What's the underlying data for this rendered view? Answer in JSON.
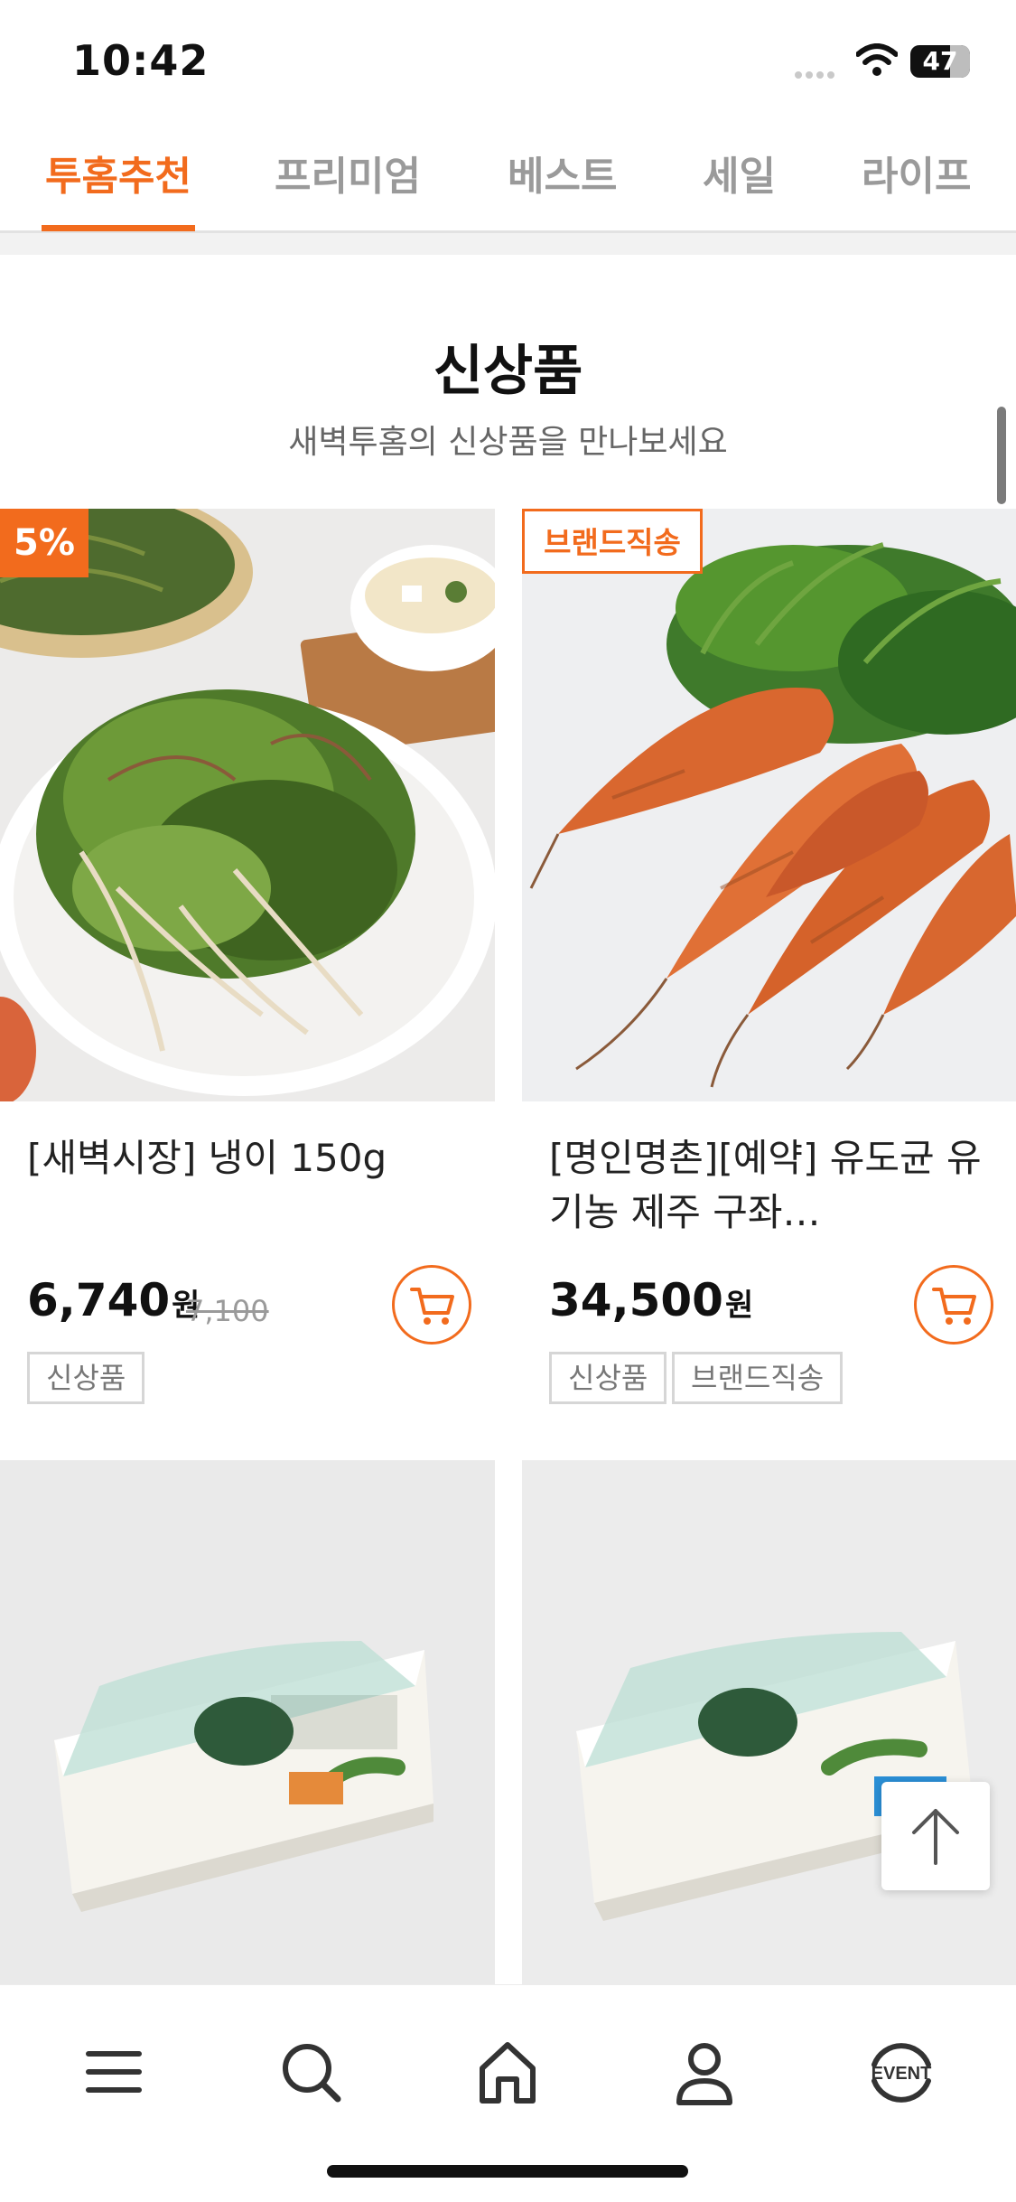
{
  "status": {
    "time": "10:42",
    "battery": "47"
  },
  "tabs": [
    {
      "label": "투홈추천",
      "active": true
    },
    {
      "label": "프리미엄"
    },
    {
      "label": "베스트"
    },
    {
      "label": "세일"
    },
    {
      "label": "라이프"
    }
  ],
  "section": {
    "title": "신상품",
    "subtitle": "새벽투홈의 신상품을 만나보세요"
  },
  "products": [
    {
      "badge": "5%",
      "name": "[새벽시장] 냉이 150g",
      "price": "6,740",
      "currency": "원",
      "original_price": "7,100",
      "tags": [
        "신상품"
      ]
    },
    {
      "badge": "브랜드직송",
      "name": "[명인명촌][예약] 유도균 유기농 제주 구좌…",
      "price": "34,500",
      "currency": "원",
      "tags": [
        "신상품",
        "브랜드직송"
      ]
    }
  ],
  "colors": {
    "accent": "#f26b1d"
  },
  "icons": [
    "menu-icon",
    "search-icon",
    "home-icon",
    "user-icon",
    "event-icon",
    "cart-icon",
    "arrow-up-icon"
  ],
  "nav": {
    "event_label": "EVENT"
  }
}
